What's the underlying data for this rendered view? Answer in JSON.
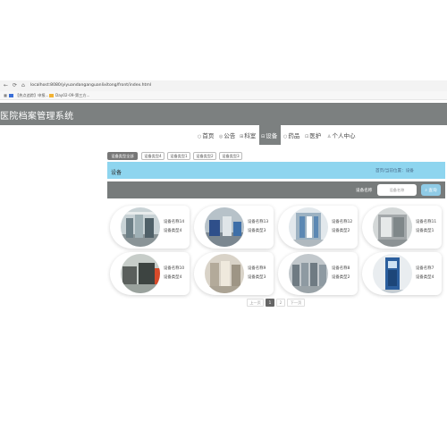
{
  "browser": {
    "url": "localhost:8080/yiyuandanganguanlixitong/front/index.html",
    "bookmarks": [
      {
        "label": "【热点追踪】申报..."
      },
      {
        "label": "Day02-09-第三方..."
      }
    ]
  },
  "header": {
    "title": "医院档案管理系统"
  },
  "nav": {
    "items": [
      {
        "label": "首页",
        "icon": "home-icon"
      },
      {
        "label": "公告",
        "icon": "notice-icon"
      },
      {
        "label": "科室",
        "icon": "department-icon"
      },
      {
        "label": "设备",
        "icon": "equipment-icon"
      },
      {
        "label": "药品",
        "icon": "medicine-icon"
      },
      {
        "label": "医护",
        "icon": "staff-icon"
      },
      {
        "label": "个人中心",
        "icon": "user-icon"
      }
    ],
    "active": "设备"
  },
  "categories": [
    {
      "label": "设备类型全部",
      "active": true
    },
    {
      "label": "设备类型4",
      "active": false
    },
    {
      "label": "设备类型1",
      "active": false
    },
    {
      "label": "设备类型2",
      "active": false
    },
    {
      "label": "设备类型3",
      "active": false
    }
  ],
  "section": {
    "title": "设备",
    "breadcrumb": "首页/当前位置：设备"
  },
  "search": {
    "label": "设备名称",
    "placeholder": "设备名称",
    "button_label": "查询"
  },
  "cards": [
    {
      "name": "设备名称14",
      "type": "设备类型4",
      "img": "a"
    },
    {
      "name": "设备名称13",
      "type": "设备类型3",
      "img": "b"
    },
    {
      "name": "设备名称12",
      "type": "设备类型2",
      "img": "c"
    },
    {
      "name": "设备名称11",
      "type": "设备类型1",
      "img": "d"
    },
    {
      "name": "设备名称10",
      "type": "设备类型4",
      "img": "e"
    },
    {
      "name": "设备名称9",
      "type": "设备类型3",
      "img": "f"
    },
    {
      "name": "设备名称8",
      "type": "设备类型2",
      "img": "g"
    },
    {
      "name": "设备名称7",
      "type": "设备类型4",
      "img": "h"
    }
  ],
  "pagination": {
    "prev": "上一页",
    "pages": [
      "1",
      "2"
    ],
    "current": "1",
    "next": "下一页"
  }
}
